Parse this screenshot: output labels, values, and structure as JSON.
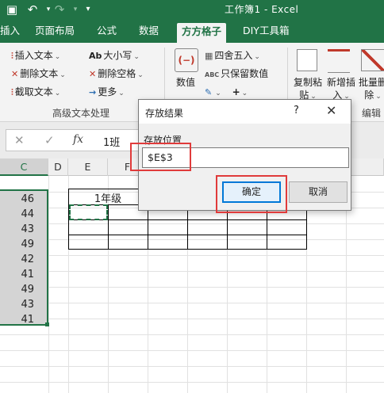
{
  "titlebar": {
    "title": "工作簿1 - Excel",
    "undo_icon": "undo-icon",
    "redo_icon": "redo-icon",
    "accent": "#217346"
  },
  "tabs": [
    "插入",
    "页面布局",
    "公式",
    "数据",
    "方方格子",
    "DIY工具箱"
  ],
  "active_tab": "方方格子",
  "ribbon": {
    "text_group": {
      "items": [
        "插入文本",
        "删除文本",
        "截取文本"
      ],
      "case_items": [
        "大小写",
        "删除空格",
        "更多"
      ],
      "label": "高级文本处理"
    },
    "number_group": {
      "big": "数值",
      "round": "四舍五入",
      "keep_number": "只保留数值",
      "abc": "ABC"
    },
    "right_group": {
      "copy_paste": "复制粘贴",
      "new_insert": "新增插入",
      "batch_delete": "批量删除",
      "label": "编辑"
    }
  },
  "formula_bar": {
    "value": "1班"
  },
  "columns": [
    "C",
    "D",
    "E",
    "F"
  ],
  "c_values": [
    "46",
    "44",
    "43",
    "49",
    "42",
    "41",
    "49",
    "43",
    "41"
  ],
  "table_header": "1年级",
  "dialog": {
    "title": "存放结果",
    "help": "?",
    "field_label": "存放位置",
    "field_value": "$E$3",
    "ok": "确定",
    "cancel": "取消",
    "highlight_color": "#e03b3b"
  }
}
